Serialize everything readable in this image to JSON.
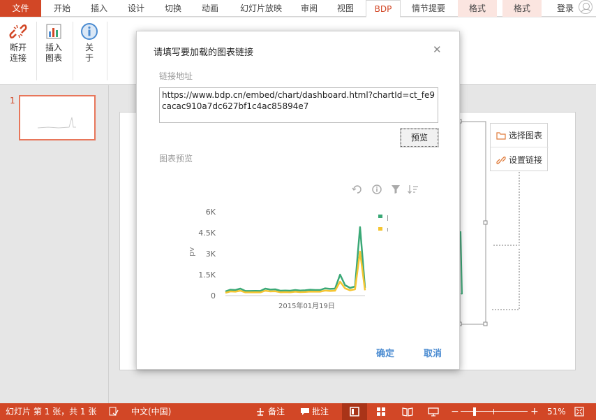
{
  "ribbon_tabs": [
    "文件",
    "开始",
    "插入",
    "设计",
    "切换",
    "动画",
    "幻灯片放映",
    "审阅",
    "视图",
    "BDP",
    "情节提要",
    "格式",
    "格式",
    "登录"
  ],
  "ribbon_buttons": {
    "disconnect": {
      "line1": "断开",
      "line2": "连接"
    },
    "insert_chart": {
      "line1": "插入",
      "line2": "图表"
    },
    "about": {
      "line1": "关",
      "line2": "于"
    }
  },
  "collapse_glyph": "︿",
  "slide_number": "1",
  "side_buttons": {
    "select_chart": "选择图表",
    "set_link": "设置链接"
  },
  "dialog": {
    "title": "请填写要加载的图表链接",
    "close_glyph": "✕",
    "link_label": "链接地址",
    "url_value": "https://www.bdp.cn/embed/chart/dashboard.html?chartId=ct_fe9cacac910a7dc627bf1c4ac85894e7",
    "preview_button": "预览",
    "preview_label": "图表预览",
    "ok_button": "确定",
    "cancel_button": "取消"
  },
  "chart_data": {
    "type": "line",
    "ylabel": "pv",
    "xlabel": "",
    "yticks": [
      "6K",
      "4.5K",
      "3K",
      "1.5K",
      "0"
    ],
    "ylim": [
      0,
      6000
    ],
    "x_tick_label": "2015年01月19日",
    "legend_position": "top-right",
    "series": [
      {
        "name": "pv",
        "color": "#3aa876",
        "values": [
          300,
          420,
          400,
          500,
          330,
          330,
          340,
          330,
          500,
          430,
          450,
          350,
          360,
          350,
          400,
          360,
          380,
          420,
          400,
          400,
          520,
          480,
          500,
          1500,
          750,
          550,
          650,
          4900,
          550
        ]
      },
      {
        "name": "uv",
        "color": "#f5c531",
        "values": [
          200,
          300,
          280,
          350,
          230,
          230,
          240,
          230,
          350,
          300,
          310,
          240,
          250,
          240,
          280,
          250,
          260,
          290,
          280,
          280,
          360,
          330,
          350,
          1000,
          520,
          380,
          450,
          3150,
          380
        ]
      }
    ]
  },
  "status": {
    "slide_info": "幻灯片 第 1 张，共 1 张",
    "language": "中文(中国)",
    "notes": "备注",
    "comments": "批注",
    "zoom": "51%"
  }
}
